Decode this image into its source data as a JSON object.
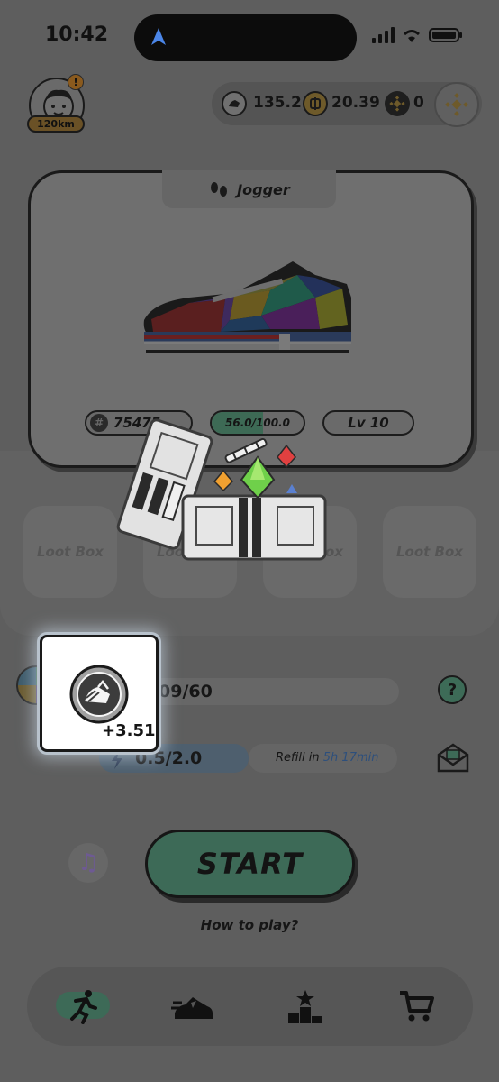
{
  "status_bar": {
    "time": "10:42"
  },
  "profile": {
    "badge": "!",
    "distance": "120km"
  },
  "balances": [
    {
      "icon": "gst-token-icon",
      "value": "135.2"
    },
    {
      "icon": "gmt-token-icon",
      "value": "20.39"
    },
    {
      "icon": "bnb-token-icon",
      "value": "0"
    }
  ],
  "sneaker": {
    "type": "Jogger",
    "id": "75475",
    "durability": "56.0/100.0",
    "durability_value": 0.56,
    "level": "Lv 10"
  },
  "loot_boxes": [
    {
      "label": "Loot Box"
    },
    {
      "label": "Loot Box"
    },
    {
      "label": "Loot Box"
    },
    {
      "label": "Loot Box"
    }
  ],
  "energy": {
    "value": "09/60"
  },
  "stamina": {
    "value": "0.5/2.0",
    "refill_label": "Refill in",
    "refill_time": "5h 17min"
  },
  "reward": {
    "amount": "+3.51"
  },
  "start_label": "START",
  "how_to_play": "How to play?",
  "colors": {
    "accent_green": "#3d6a57",
    "overlay": "#5e5e5e"
  }
}
